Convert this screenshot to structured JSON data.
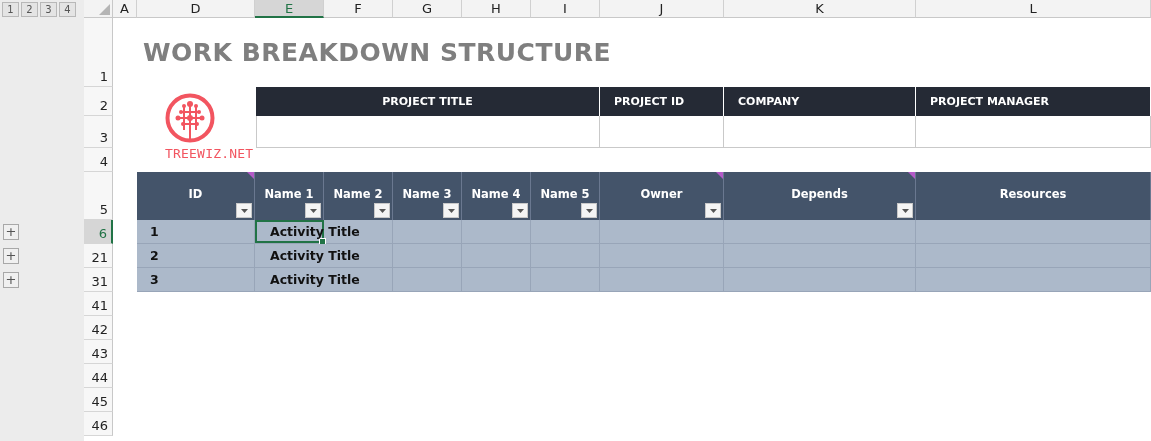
{
  "outline_levels": [
    "1",
    "2",
    "3",
    "4"
  ],
  "column_headers": [
    {
      "label": "A",
      "selected": false
    },
    {
      "label": "D",
      "selected": false
    },
    {
      "label": "E",
      "selected": true
    },
    {
      "label": "F",
      "selected": false
    },
    {
      "label": "G",
      "selected": false
    },
    {
      "label": "H",
      "selected": false
    },
    {
      "label": "I",
      "selected": false
    },
    {
      "label": "J",
      "selected": false
    },
    {
      "label": "K",
      "selected": false
    },
    {
      "label": "L",
      "selected": false
    }
  ],
  "row_headers": [
    {
      "label": "1",
      "selected": false
    },
    {
      "label": "2",
      "selected": false
    },
    {
      "label": "3",
      "selected": false
    },
    {
      "label": "4",
      "selected": false
    },
    {
      "label": "5",
      "selected": false
    },
    {
      "label": "6",
      "selected": true,
      "group_button": "+"
    },
    {
      "label": "21",
      "selected": false,
      "group_button": "+"
    },
    {
      "label": "31",
      "selected": false,
      "group_button": "+"
    },
    {
      "label": "41",
      "selected": false
    },
    {
      "label": "42",
      "selected": false
    },
    {
      "label": "43",
      "selected": false
    },
    {
      "label": "44",
      "selected": false
    },
    {
      "label": "45",
      "selected": false
    },
    {
      "label": "46",
      "selected": false
    }
  ],
  "title": "WORK BREAKDOWN STRUCTURE",
  "logo": {
    "text": "TREEWIZ.NET"
  },
  "project_fields": [
    "PROJECT TITLE",
    "PROJECT ID",
    "COMPANY",
    "PROJECT MANAGER"
  ],
  "table": {
    "columns": [
      {
        "label": "ID",
        "filter": true,
        "comment": true
      },
      {
        "label": "Name 1",
        "filter": true,
        "comment": false
      },
      {
        "label": "Name 2",
        "filter": true,
        "comment": false
      },
      {
        "label": "Name 3",
        "filter": true,
        "comment": false
      },
      {
        "label": "Name 4",
        "filter": true,
        "comment": false
      },
      {
        "label": "Name 5",
        "filter": true,
        "comment": false
      },
      {
        "label": "Owner",
        "filter": true,
        "comment": true
      },
      {
        "label": "Depends",
        "filter": true,
        "comment": true
      },
      {
        "label": "Resources",
        "filter": false,
        "comment": false
      }
    ],
    "rows": [
      {
        "id": "1",
        "activity": "Activity Title",
        "selected": true
      },
      {
        "id": "2",
        "activity": "Activity Title",
        "selected": false
      },
      {
        "id": "3",
        "activity": "Activity Title",
        "selected": false
      }
    ]
  }
}
